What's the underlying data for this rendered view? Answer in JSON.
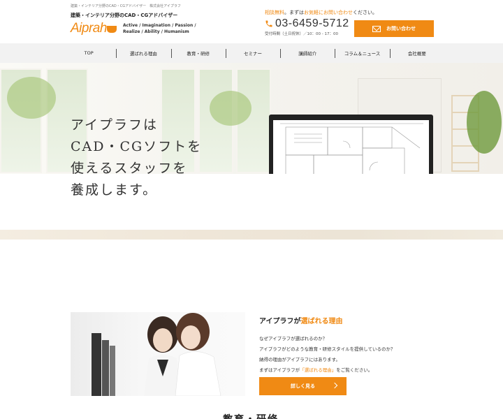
{
  "header": {
    "topline": "建築・インテリア分野のCAD・CGアドバイザー　株式会社アイプラフ",
    "catch": "建築・インテリア分野のCAD・CGアドバイザー",
    "logo_text": "Aiprah",
    "motto_lines": [
      "Active / Imagination / Passion /",
      "Realize / Ability / Humanism"
    ],
    "consult_prefix": "相談無料",
    "consult_mid": "。まずは",
    "consult_highlight": "お気軽にお問い合わせ",
    "consult_suffix": "ください。",
    "phone": "03-6459-5712",
    "hours": "受付時間（土日祝休）／10：00 - 17：00",
    "contact_button": "お問い合わせ"
  },
  "nav": {
    "items": [
      "TOP",
      "選ばれる理由",
      "教育・研修",
      "セミナー",
      "講師紹介",
      "コラム＆ニュース",
      "会社概要"
    ]
  },
  "hero": {
    "lines": [
      "アイプラフは",
      "CAD・CGソフトを",
      "使えるスタッフを",
      "養成します。"
    ]
  },
  "reason": {
    "title_prefix": "アイプラフが",
    "title_highlight": "選ばれる理由",
    "body_1": "なぜアイプラフが選ばれるのか？",
    "body_2": "アイプラフがどのような教育・研修スタイルを提供しているのか？",
    "body_3": "納得の理由がアイプラフにはあります。",
    "body_4_prefix": "まずはアイプラフが",
    "body_4_highlight": "「選ばれる理由」",
    "body_4_suffix": "をご覧ください。",
    "button": "詳しく見る"
  },
  "next_section": {
    "title": "教育・研修"
  },
  "colors": {
    "accent": "#f08a14",
    "nav_bg": "#f2f2f2"
  }
}
